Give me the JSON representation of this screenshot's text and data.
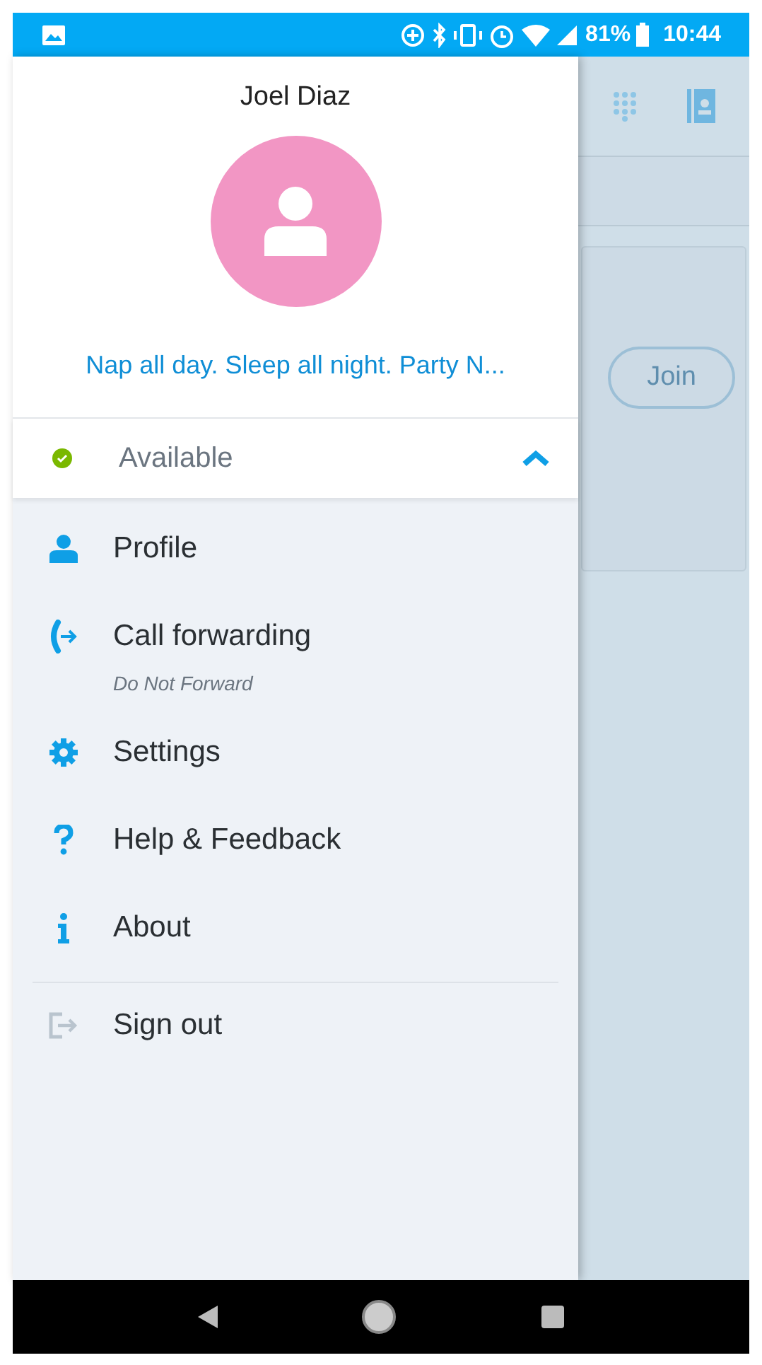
{
  "status_bar": {
    "battery": "81%",
    "time": "10:44"
  },
  "drawer": {
    "name": "Joel Diaz",
    "mood": "Nap all day. Sleep all night. Party N...",
    "presence": {
      "label": "Available",
      "color": "#7ab800",
      "expanded": true
    },
    "menu": [
      {
        "kind": "profile",
        "label": "Profile"
      },
      {
        "kind": "forwarding",
        "label": "Call forwarding",
        "subtitle": "Do Not Forward"
      },
      {
        "kind": "settings",
        "label": "Settings"
      },
      {
        "kind": "help",
        "label": "Help & Feedback"
      },
      {
        "kind": "about",
        "label": "About"
      },
      {
        "kind": "signout",
        "label": "Sign out"
      }
    ]
  },
  "background": {
    "join_button": "Join"
  }
}
